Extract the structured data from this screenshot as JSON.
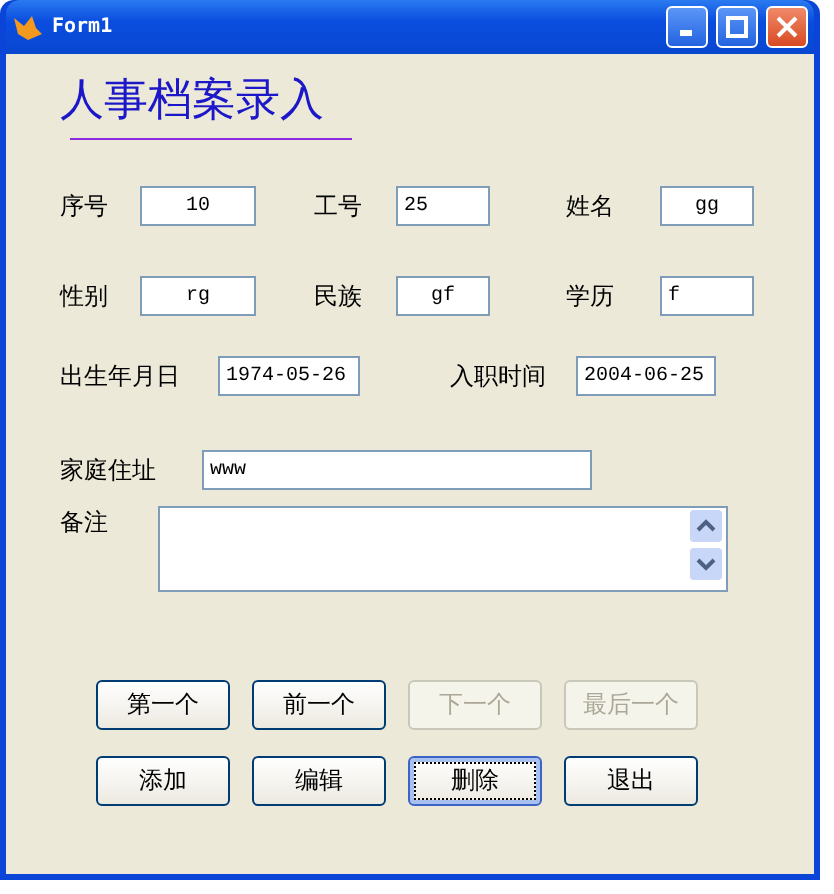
{
  "window": {
    "title": "Form1"
  },
  "heading": "人事档案录入",
  "rows": [
    [
      {
        "label": "序号",
        "value": "10"
      },
      {
        "label": "工号",
        "value": "25"
      },
      {
        "label": "姓名",
        "value": "gg"
      }
    ],
    [
      {
        "label": "性别",
        "value": "rg"
      },
      {
        "label": "民族",
        "value": "gf"
      },
      {
        "label": "学历",
        "value": "f"
      }
    ],
    [
      {
        "label": "出生年月日",
        "value": "1974-05-26"
      },
      {
        "label": "入职时间",
        "value": "2004-06-25"
      }
    ],
    [
      {
        "label": "家庭住址",
        "value": "www"
      }
    ]
  ],
  "notes": {
    "label": "备注"
  },
  "buttons": [
    [
      {
        "label": "第一个",
        "disabled": false,
        "focused": false
      },
      {
        "label": "前一个",
        "disabled": false,
        "focused": false
      },
      {
        "label": "下一个",
        "disabled": true,
        "focused": false
      },
      {
        "label": "最后一个",
        "disabled": true,
        "focused": false
      }
    ],
    [
      {
        "label": "添加",
        "disabled": false,
        "focused": false
      },
      {
        "label": "编辑",
        "disabled": false,
        "focused": false
      },
      {
        "label": "删除",
        "disabled": false,
        "focused": true
      },
      {
        "label": "退出",
        "disabled": false,
        "focused": false
      }
    ]
  ]
}
